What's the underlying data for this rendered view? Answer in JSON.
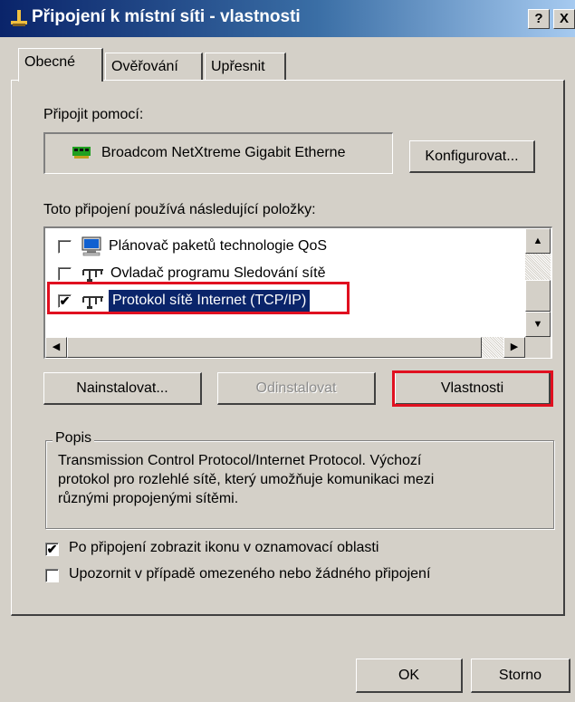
{
  "window": {
    "title": "Připojení k místní síti - vlastnosti",
    "help_btn": "?",
    "close_btn": "X"
  },
  "tabs": [
    {
      "label": "Obecné",
      "active": true
    },
    {
      "label": "Ověřování",
      "active": false
    },
    {
      "label": "Upřesnit",
      "active": false
    }
  ],
  "connect_using": {
    "label": "Připojit pomocí:",
    "adapter_name": "Broadcom NetXtreme Gigabit Etherne",
    "configure_button": "Konfigurovat..."
  },
  "components": {
    "label": "Toto připojení používá následující položky:",
    "items": [
      {
        "label": "Plánovač paketů technologie QoS",
        "checked": false,
        "icon": "qos-scheduler-icon"
      },
      {
        "label": "Ovladač programu Sledování sítě",
        "checked": false,
        "icon": "network-protocol-icon"
      },
      {
        "label": "Protokol sítě Internet (TCP/IP)",
        "checked": true,
        "selected": true,
        "icon": "network-protocol-icon"
      }
    ]
  },
  "action_buttons": {
    "install": "Nainstalovat...",
    "uninstall": "Odinstalovat",
    "properties": "Vlastnosti"
  },
  "description": {
    "legend": "Popis",
    "line1": "Transmission Control Protocol/Internet Protocol. Výchozí",
    "line2": "protokol pro rozlehlé sítě, který umožňuje komunikaci mezi",
    "line3": "různými propojenými sítěmi."
  },
  "options": {
    "show_icon": {
      "label": "Po připojení zobrazit ikonu v oznamovací oblasti",
      "checked": true
    },
    "notify": {
      "label": "Upozornit v případě omezeného nebo žádného připojení",
      "checked": false
    }
  },
  "footer": {
    "ok": "OK",
    "cancel": "Storno"
  },
  "colors": {
    "highlight": "#0a246a",
    "annotation_red": "#e01020"
  }
}
